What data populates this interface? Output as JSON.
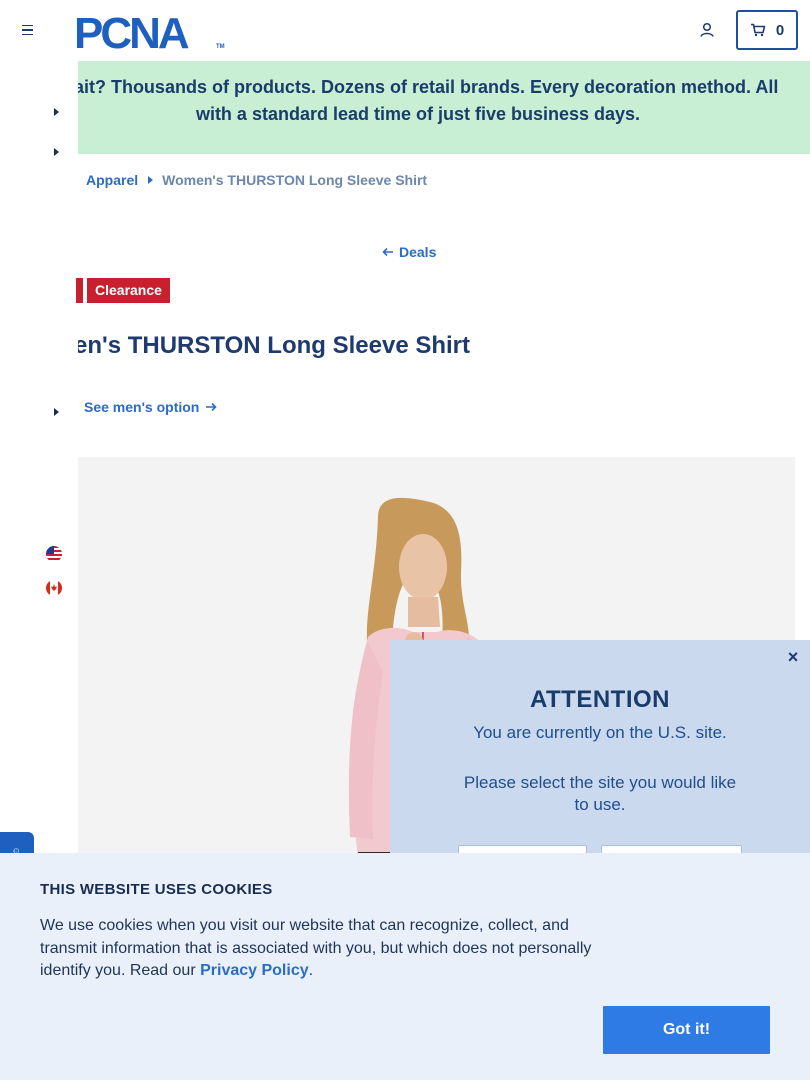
{
  "header": {
    "logo_text": "PCNA",
    "logo_tm": "TM",
    "cart_count": "0"
  },
  "promo": {
    "text": "Wait? Thousands of products. Dozens of retail brands. Every decoration method. All with a standard lead time of just five business days."
  },
  "breadcrumb": {
    "items": [
      "Apparel",
      "Women's THURSTON Long Sleeve Shirt"
    ]
  },
  "back_link": {
    "label": "Deals"
  },
  "badges": {
    "clearance": "Clearance"
  },
  "product": {
    "title": "Women's THURSTON Long Sleeve Shirt",
    "alt_link": "See men's option"
  },
  "modal": {
    "heading": "ATTENTION",
    "line1": "You are currently on the U.S. site.",
    "line2": "Please select the site you would like to use."
  },
  "cookie": {
    "title": "THIS WEBSITE USES COOKIES",
    "text_before": "We use cookies when you visit our website that can recognize, collect, and transmit information that is associated with you, but which does not personally identify you. Read our ",
    "link": "Privacy Policy",
    "text_after": ".",
    "button": "Got it!"
  },
  "colors": {
    "brand_blue": "#1f4f9e",
    "link_blue": "#2b6cc4",
    "promo_bg": "#c8eed4",
    "clearance_red": "#c8202f",
    "modal_bg": "#cbd9ee",
    "cookie_bg": "#eaf0f9",
    "cookie_button": "#2e7be6"
  },
  "icons": [
    "menu-icon",
    "account-icon",
    "cart-icon",
    "chevron-right-icon",
    "arrow-left-icon",
    "arrow-right-icon",
    "us-flag-icon",
    "canada-flag-icon",
    "close-icon"
  ]
}
